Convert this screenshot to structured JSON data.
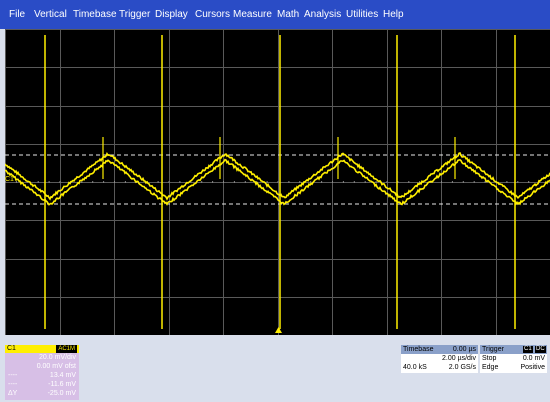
{
  "menu": [
    "File",
    "Vertical",
    "Timebase",
    "Trigger",
    "Display",
    "Cursors",
    "Measure",
    "Math",
    "Analysis",
    "Utilities",
    "Help"
  ],
  "colors": {
    "menubar": "#2a4cc6",
    "trace": "#ffef00",
    "grid": "#595959",
    "c1_panel": "#d7bfe6",
    "panel_header": "#8aa0c9"
  },
  "scope": {
    "channel_marker": "C1",
    "trigger_marker_icon": "triangle-up"
  },
  "c1": {
    "label": "C1",
    "coupling": "AC1M",
    "vdiv": "20.0 mV/div",
    "offset": "0.00 mV ofst",
    "rows": [
      {
        "k": "----",
        "v": "13.4 mV"
      },
      {
        "k": "----",
        "v": "-11.6 mV"
      },
      {
        "k": "ΔY",
        "v": "-25.0 mV"
      }
    ]
  },
  "timebase": {
    "label": "Timebase",
    "delay": "0.00 µs",
    "tdiv": "2.00 µs/div",
    "samples": "40.0 kS",
    "rate": "2.0 GS/s"
  },
  "trigger": {
    "label": "Trigger",
    "badges": [
      "C1",
      "DC"
    ],
    "mode": "Stop",
    "level": "0.0 mV",
    "type": "Edge",
    "slope": "Positive"
  }
}
